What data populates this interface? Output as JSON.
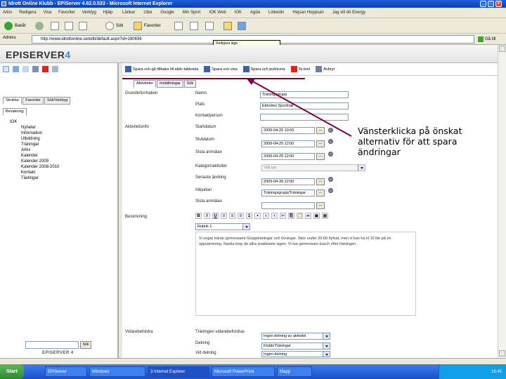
{
  "window": {
    "title": "Idrott Online Klubb - EPiServer 4.62.0.533 - Microsoft Internet Explorer",
    "controls": [
      "_",
      "□",
      "x"
    ]
  },
  "menu": {
    "items": [
      "Arkiv",
      "Redigera",
      "Visa",
      "Favoriter",
      "Verktyg",
      "Hjälp"
    ],
    "links": [
      "Länkar",
      "Ubsi",
      "Google",
      "Min Sport",
      "IOK Web",
      "IOK",
      "Agda",
      "Linkedin",
      "Hejsan Hoppsan",
      "Jag vill dö Energy"
    ]
  },
  "nav": {
    "back_label": "Bakåt",
    "search_label": "Sök",
    "favorites_label": "Favoriter"
  },
  "address": {
    "label": "Adress",
    "url": "http://www.idrottonline.se/edit/default.aspx?id=190636",
    "go_label": "Gå till",
    "tooltip": "Redigera läge"
  },
  "brand": {
    "name": "EPISERVER",
    "version": "4"
  },
  "left": {
    "tabs": [
      "Struktur",
      "Favoriter",
      "Sök/Verktyg"
    ],
    "subtab": "Bevakning",
    "tree": [
      "IOK",
      "Nyheter",
      "Information",
      "Utbildning",
      "Träningar",
      "Arkiv",
      "Kalender",
      "Kalender 2009",
      "Kalender 2008-2010",
      "Kontakt",
      "Tävlingar"
    ],
    "go_label": "Sök",
    "footer": "EPISERVER 4"
  },
  "actions": [
    {
      "icon": "save-icon",
      "label": "Spara och gå tillbaka till aktiv tabbsida"
    },
    {
      "icon": "save-icon",
      "label": "Spara och visa"
    },
    {
      "icon": "save-icon",
      "label": "Spara och publicera"
    },
    {
      "icon": "delete-icon",
      "label": "Ta bort"
    },
    {
      "icon": "cancel-icon",
      "label": "Avbryt"
    }
  ],
  "main": {
    "tabs": [
      "Aktiviteter",
      "Inställningar",
      "Sök"
    ],
    "groups": [
      "Grundinformation",
      "Aktivitetsinfo",
      "Beskrivning",
      "Vidarebefordra"
    ],
    "fields": {
      "name": {
        "label": "Namn",
        "value": "Träningsgrupp"
      },
      "place": {
        "label": "Plats",
        "value": "Ekholms Sporthall"
      },
      "contact": {
        "label": "Kontaktperson",
        "value": ""
      },
      "start": {
        "label": "Startdatum",
        "value": "2009-04-25 10:00"
      },
      "stop": {
        "label": "Slutdatum",
        "value": "2009-04-25 12:00"
      },
      "reg_deadline": {
        "label": "Sista anmälan",
        "value": "2009-04-25 12:00"
      },
      "category": {
        "label": "Kategori/aktivitet",
        "value": "Välj typ"
      },
      "last_change": {
        "label": "Senaste ändring",
        "value": "2009-04-30 22:00"
      },
      "invite": {
        "label": "Inbjudan",
        "value": "Träningsgrupp/Träningar"
      },
      "final": {
        "label": "Sista anmälan",
        "value": ""
      },
      "editor_style": "Rubrik 1",
      "description": "Vi ungar tränar gemensamt Gruppträningar och övningar. Skor under 20:00 hyfsat, men vi kan ha kl 10 lite på en uppvärmning. Samla ihop de allra snabbaste lagen. Vi har gemensam dusch efter träningen.",
      "forward": [
        {
          "label": "Träningen vidarebefordras",
          "value": "Ingen delning av aktivitet"
        },
        {
          "label": "Delning",
          "value": "Klubb/Träningar"
        },
        {
          "label": "Vid delning",
          "value": "Ingen delning"
        }
      ]
    }
  },
  "callout": {
    "text": "Vänsterklicka på önskat alternativ för att spara ändringar"
  },
  "colors": {
    "callout_line": "#800040",
    "title_bar": "#0a3fb5",
    "brand_accent": "#3c8acd"
  },
  "taskbar": {
    "start_label": "Start",
    "buttons": [
      "EPiServer",
      "Windows",
      "3 Internet Explorer",
      "Microsoft PowerPoint",
      "Mapp"
    ],
    "clock": "16:45"
  }
}
